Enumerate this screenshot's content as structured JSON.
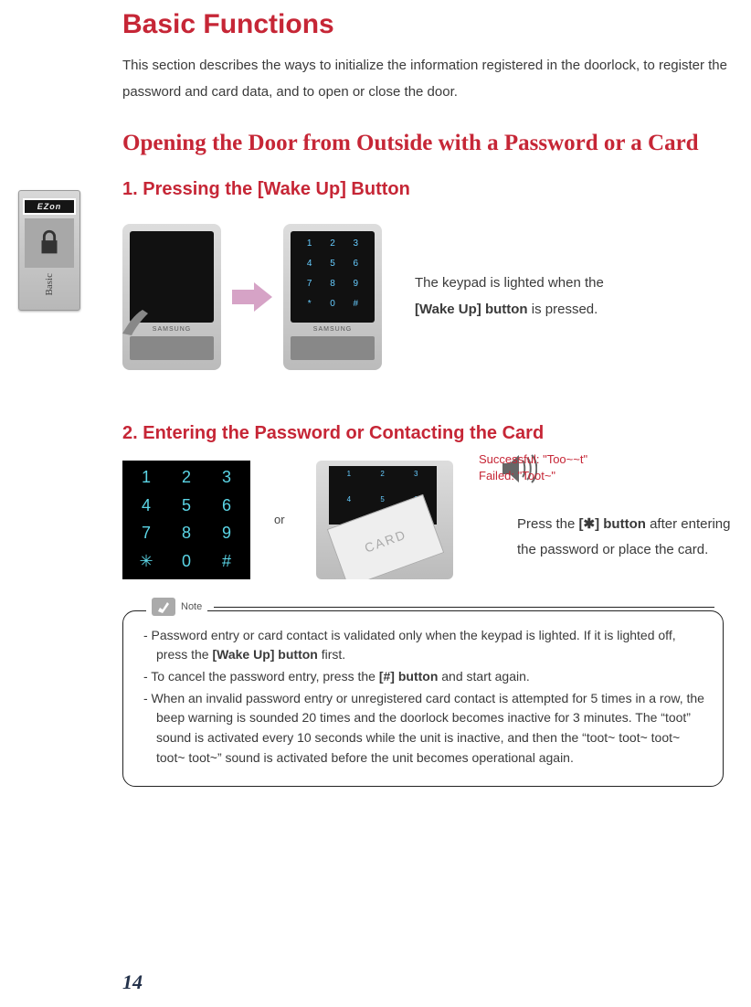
{
  "title": "Basic Functions",
  "intro": "This section describes the ways to initialize the information registered in the doorlock, to register the password and card data, and to open or close the door.",
  "section": "Opening the Door from Outside with a Password or a Card",
  "step1_heading": "1. Pressing the [Wake Up] Button",
  "tab_ezon": "EZon",
  "tab_label": "Basic",
  "brand": "SAMSUNG",
  "caption1_pre": "The keypad is lighted when the ",
  "caption1_bold": "[Wake Up] button",
  "caption1_post": " is pressed.",
  "step2_heading": "2. Entering the Password or Contacting the Card",
  "keypad": [
    "1",
    "2",
    "3",
    "4",
    "5",
    "6",
    "7",
    "8",
    "9",
    "✳",
    "0",
    "#"
  ],
  "or_label": "or",
  "card_label": "CARD",
  "result_success": "Successful: \"Too~~t\"",
  "result_failed": "Failed: \"Toot~\"",
  "caption2_pre": "Press the ",
  "caption2_bold": "[✱] button",
  "caption2_post": " after entering the password or place the card.",
  "note_label": "Note",
  "note_item1_pre": "- Password entry or card contact is validated only when the keypad is lighted. If it is lighted off, press the ",
  "note_item1_bold": "[Wake Up] button",
  "note_item1_post": " first.",
  "note_item2_pre": "- To cancel the password entry, press the ",
  "note_item2_bold": "[#] button",
  "note_item2_post": " and start again.",
  "note_item3": "- When an invalid password entry or unregistered card contact is attempted for 5 times in a row, the beep warning is sounded 20 times and the doorlock becomes inactive for 3 minutes. The “toot” sound is activated every 10 seconds while the unit is inactive, and then the “toot~ toot~ toot~ toot~ toot~” sound is activated before the unit becomes operational again.",
  "page_number": "14"
}
